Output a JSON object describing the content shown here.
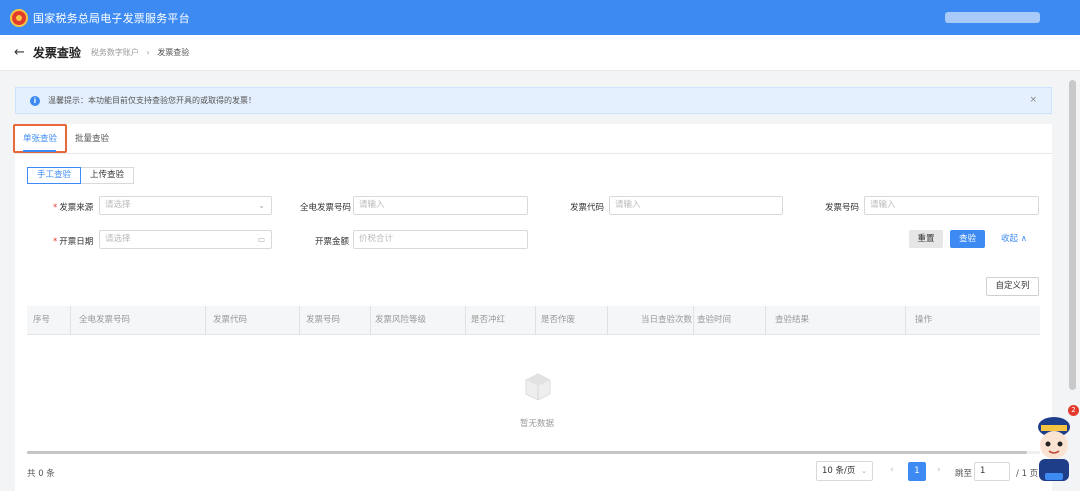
{
  "app": {
    "title": "国家税务总局电子发票服务平台"
  },
  "header": {
    "back_symbol": "←",
    "page_title": "发票查验",
    "breadcrumb": [
      "税务数字账户",
      "发票查验"
    ],
    "breadcrumb_sep": "›"
  },
  "notice": {
    "text": "温馨提示：本功能目前仅支持查验您开具的或取得的发票！",
    "close": "×"
  },
  "tabs": [
    {
      "label": "单张查验",
      "active": true
    },
    {
      "label": "批量查验",
      "active": false
    }
  ],
  "mode": {
    "manual": "手工查验",
    "upload": "上传查验"
  },
  "form": {
    "source": {
      "label": "发票来源",
      "placeholder": "请选择"
    },
    "full_no": {
      "label": "全电发票号码",
      "placeholder": "请输入"
    },
    "code": {
      "label": "发票代码",
      "placeholder": "请输入"
    },
    "number": {
      "label": "发票号码",
      "placeholder": "请输入"
    },
    "date": {
      "label": "开票日期",
      "placeholder": "请选择"
    },
    "amount": {
      "label": "开票金额",
      "placeholder": "价税合计"
    },
    "required_mark": "*"
  },
  "actions": {
    "reset": "重置",
    "query": "查验",
    "collapse": "收起 ∧",
    "custom_columns": "自定义列"
  },
  "table": {
    "columns": [
      "序号",
      "全电发票号码",
      "发票代码",
      "发票号码",
      "发票风险等级",
      "是否冲红",
      "是否作废",
      "当日查验次数",
      "查验时间",
      "查验结果",
      "操作"
    ],
    "empty_text": "暂无数据"
  },
  "pagination": {
    "total": "共 0 条",
    "page_size": "10 条/页",
    "prev": "‹",
    "next": "›",
    "current_page": "1",
    "goto_label": "跳至",
    "goto_value": "1",
    "pages_total": "/ 1 页"
  },
  "assistant": {
    "badge": "2"
  }
}
